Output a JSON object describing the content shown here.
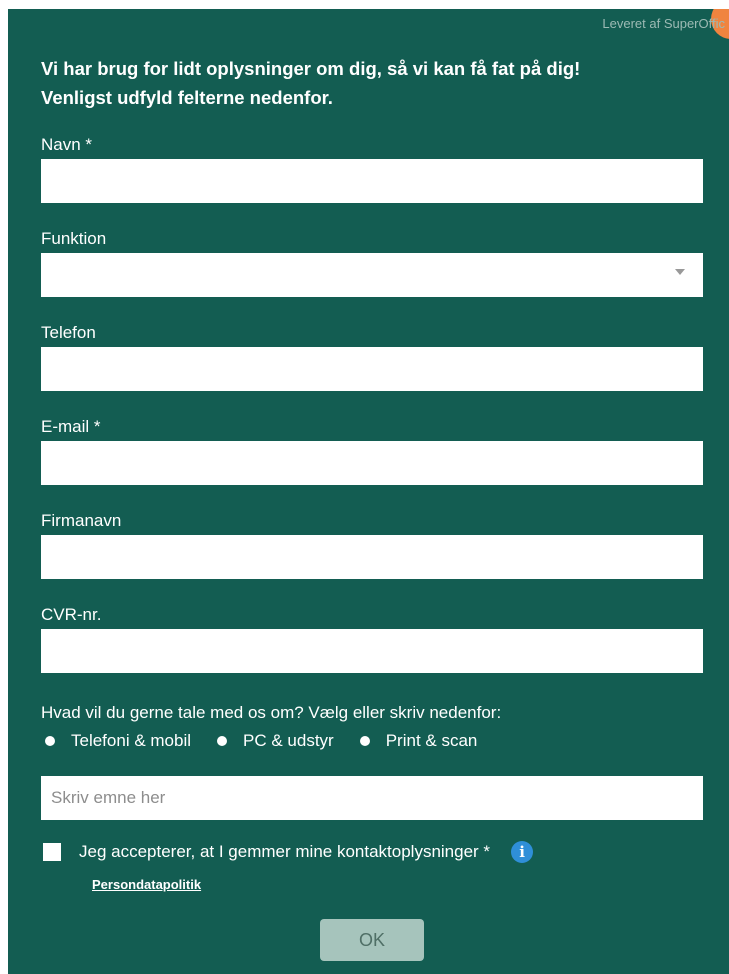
{
  "powered_by": "Leveret af SuperOffic",
  "intro": {
    "line1": "Vi har brug for lidt oplysninger om dig, så vi kan få fat på dig!",
    "line2": "Venligst udfyld felterne nedenfor."
  },
  "fields": {
    "name": {
      "label": "Navn *",
      "value": ""
    },
    "function": {
      "label": "Funktion",
      "value": ""
    },
    "phone": {
      "label": "Telefon",
      "value": ""
    },
    "email": {
      "label": "E-mail *",
      "value": ""
    },
    "company": {
      "label": "Firmanavn",
      "value": ""
    },
    "cvr": {
      "label": "CVR-nr.",
      "value": ""
    }
  },
  "topic": {
    "question": "Hvad vil du gerne tale med os om? Vælg eller skriv nedenfor:",
    "options": [
      "Telefoni & mobil",
      "PC & udstyr",
      "Print & scan"
    ],
    "placeholder": "Skriv emne her"
  },
  "consent": {
    "label": "Jeg accepterer, at I gemmer mine kontaktoplysninger *",
    "checked": false,
    "privacy_link": "Persondatapolitik"
  },
  "submit_label": "OK",
  "colors": {
    "panel_bg": "#135d52",
    "button_bg": "#a6c4bc",
    "info_icon": "#2f8fd8",
    "badge": "#f0843f"
  }
}
